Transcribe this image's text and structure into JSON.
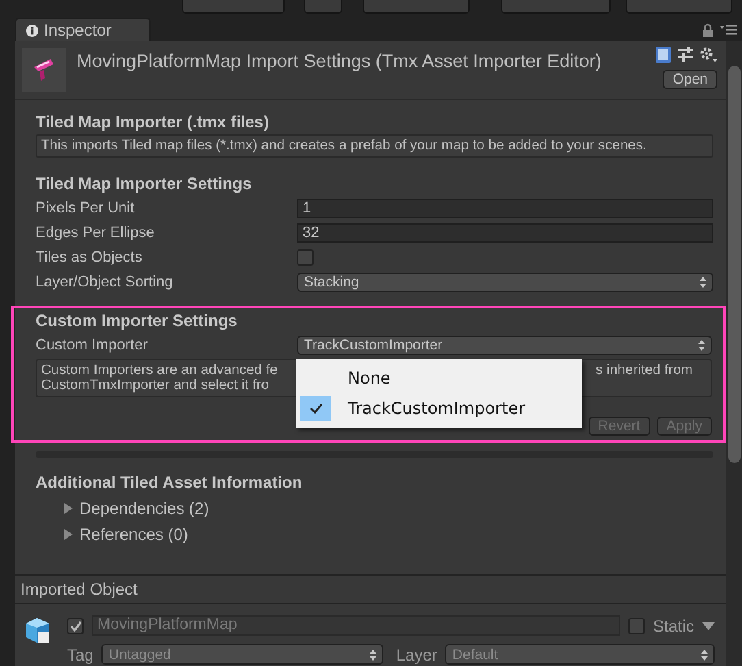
{
  "tabs": [
    {
      "label": "Inspector",
      "selected": true
    }
  ],
  "header": {
    "title": "MovingPlatformMap Import Settings (Tmx Asset Importer Editor)",
    "button": "Open"
  },
  "importer_info": {
    "heading": "Tiled Map Importer (.tmx files)",
    "help": "This imports Tiled map files (*.tmx) and creates a prefab of your map to be added to your scenes."
  },
  "importer_settings": {
    "heading": "Tiled Map Importer Settings",
    "fields": [
      {
        "kind": "text",
        "label": "Pixels Per Unit",
        "value": "1"
      },
      {
        "kind": "text",
        "label": "Edges Per Ellipse",
        "value": "32"
      },
      {
        "kind": "checkbox",
        "label": "Tiles as Objects",
        "checked": false
      },
      {
        "kind": "dropdown",
        "label": "Layer/Object Sorting",
        "value": "Stacking"
      }
    ]
  },
  "custom_importer": {
    "highlighted": true,
    "heading": "Custom Importer Settings",
    "label": "Custom Importer",
    "value": "TrackCustomImporter",
    "help_parts": [
      "Custom Importers are an advanced fe",
      "s inherited from",
      "CustomTmxImporter and select it fro"
    ],
    "buttons": [
      {
        "label": "Revert",
        "disabled": true
      },
      {
        "label": "Apply",
        "disabled": true
      }
    ]
  },
  "dropdown_menu": {
    "items": [
      {
        "label": "None",
        "selected": false
      },
      {
        "label": "TrackCustomImporter",
        "selected": true
      }
    ]
  },
  "additional_info": {
    "heading": "Additional Tiled Asset Information",
    "items": [
      {
        "label": "Dependencies (2)",
        "expanded": false
      },
      {
        "label": "References (0)",
        "expanded": false
      }
    ]
  },
  "imported_object": {
    "title": "Imported Object",
    "active": true,
    "name": "MovingPlatformMap",
    "static": false,
    "static_label": "Static",
    "tag_label": "Tag",
    "tag": "Untagged",
    "layer_label": "Layer",
    "layer": "Default"
  }
}
